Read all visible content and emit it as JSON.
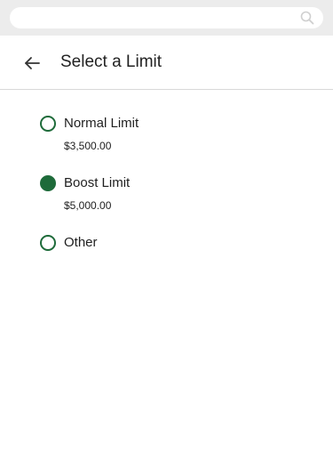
{
  "browser": {
    "search_icon": "search-icon"
  },
  "header": {
    "back_icon": "arrow-left-icon",
    "title": "Select a Limit"
  },
  "options": [
    {
      "label": "Normal Limit",
      "amount": "$3,500.00",
      "selected": false
    },
    {
      "label": "Boost Limit",
      "amount": "$5,000.00",
      "selected": true
    },
    {
      "label": "Other",
      "amount": "",
      "selected": false
    }
  ],
  "colors": {
    "accent": "#1e6b3a",
    "divider": "#d9d9d9",
    "browser_bar": "#ececec"
  }
}
